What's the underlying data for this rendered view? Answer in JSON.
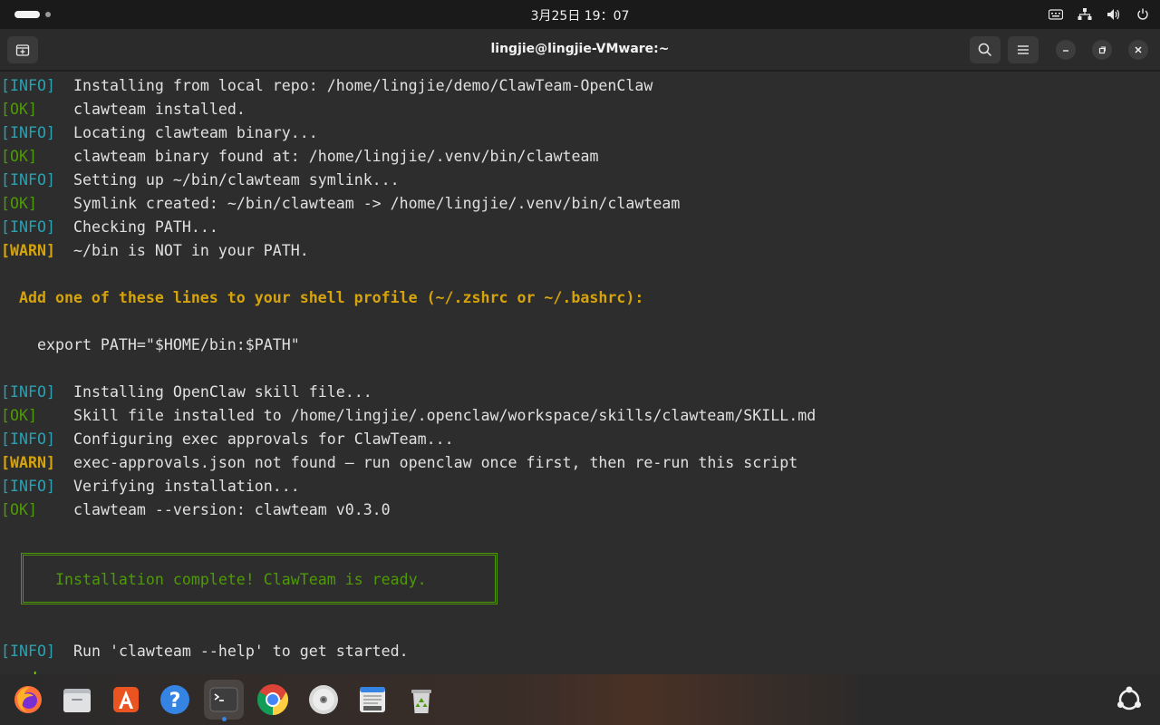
{
  "topbar": {
    "clock": "3月25日  19：07",
    "icons": [
      "keyboard-icon",
      "network-icon",
      "volume-icon",
      "power-icon"
    ]
  },
  "window": {
    "title": "lingjie@lingjie-VMware:~",
    "buttons": [
      "new-tab-icon",
      "search-icon",
      "menu-icon",
      "minimize-icon",
      "maximize-icon",
      "close-icon"
    ]
  },
  "terminal": {
    "lines": [
      {
        "tag": "[INFO]",
        "text": "Installing from local repo: /home/lingjie/demo/ClawTeam-OpenClaw"
      },
      {
        "tag": "[OK]",
        "text": "clawteam installed."
      },
      {
        "tag": "[INFO]",
        "text": "Locating clawteam binary..."
      },
      {
        "tag": "[OK]",
        "text": "clawteam binary found at: /home/lingjie/.venv/bin/clawteam"
      },
      {
        "tag": "[INFO]",
        "text": "Setting up ~/bin/clawteam symlink..."
      },
      {
        "tag": "[OK]",
        "text": "Symlink created: ~/bin/clawteam -> /home/lingjie/.venv/bin/clawteam"
      },
      {
        "tag": "[INFO]",
        "text": "Checking PATH..."
      },
      {
        "tag": "[WARN]",
        "text": "~/bin is NOT in your PATH."
      }
    ],
    "profile_hint": "Add one of these lines to your shell profile (~/.zshrc or ~/.bashrc):",
    "export_line": "export PATH=\"$HOME/bin:$PATH\"",
    "lines2": [
      {
        "tag": "[INFO]",
        "text": "Installing OpenClaw skill file..."
      },
      {
        "tag": "[OK]",
        "text": "Skill file installed to /home/lingjie/.openclaw/workspace/skills/clawteam/SKILL.md"
      },
      {
        "tag": "[INFO]",
        "text": "Configuring exec approvals for ClawTeam..."
      },
      {
        "tag": "[WARN]",
        "text": "exec-approvals.json not found — run openclaw once first, then re-run this script"
      },
      {
        "tag": "[INFO]",
        "text": "Verifying installation..."
      },
      {
        "tag": "[OK]",
        "text": "clawteam --version: clawteam v0.3.0"
      }
    ],
    "complete_message": "Installation complete! ClawTeam is ready.",
    "final_line": {
      "tag": "[INFO]",
      "text": "Run 'clawteam --help' to get started."
    },
    "prompt_partial": "> cd",
    "colors": {
      "info": "#2aa1b3",
      "ok": "#4e9a06",
      "warn": "#d5a30c",
      "background": "#2d2d2d"
    }
  },
  "dock": {
    "apps": [
      "firefox-icon",
      "files-icon",
      "app-center-icon",
      "help-icon",
      "terminal-icon",
      "chrome-icon",
      "disc-icon",
      "text-editor-icon",
      "trash-icon"
    ],
    "active_app": "terminal-icon",
    "show_apps": "show-apps-icon"
  }
}
